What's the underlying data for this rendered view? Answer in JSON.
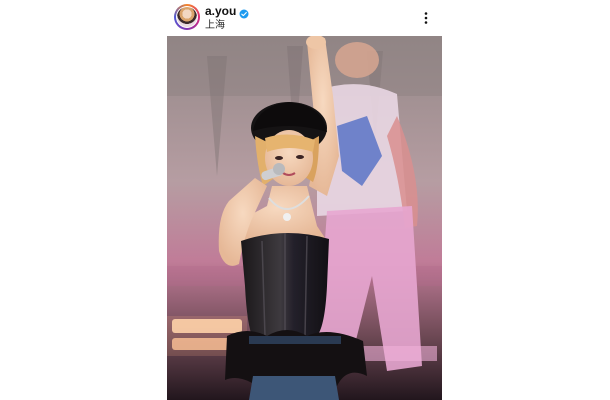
{
  "post": {
    "username": "a.you",
    "location": "上海",
    "verified": true
  },
  "icons": {
    "avatar": "profile-avatar",
    "verified": "verified-badge-icon",
    "more": "more-options-icon"
  },
  "colors": {
    "verified_blue": "#1d9bf0",
    "text": "#111111"
  }
}
